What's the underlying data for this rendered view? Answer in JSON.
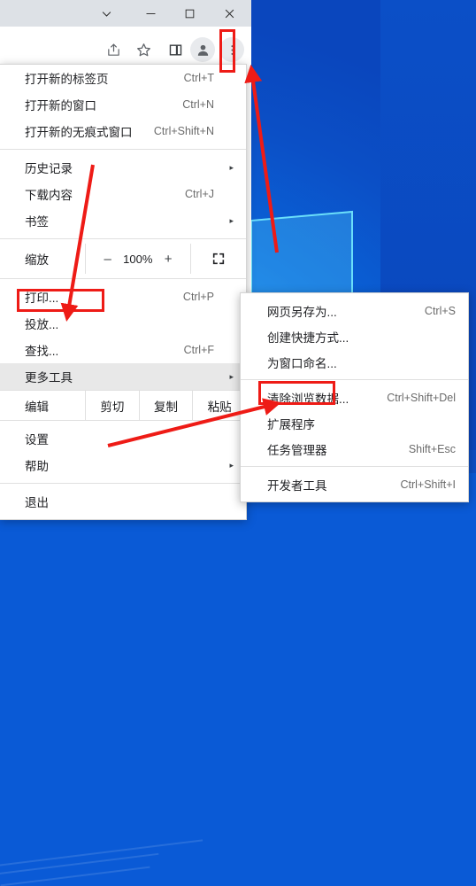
{
  "window": {
    "controls": [
      {
        "name": "chevron-down",
        "glyph": "⌄"
      },
      {
        "name": "minimize",
        "glyph": "—"
      },
      {
        "name": "maximize",
        "glyph": "◻"
      },
      {
        "name": "close",
        "glyph": "✕"
      }
    ]
  },
  "toolbar": {
    "icons": [
      "share-icon",
      "bookmark-star-icon",
      "side-panel-icon",
      "profile-avatar-icon",
      "three-dot-menu-icon"
    ]
  },
  "menu": {
    "group1": [
      {
        "label": "打开新的标签页",
        "accel": "Ctrl+T",
        "arrow": ""
      },
      {
        "label": "打开新的窗口",
        "accel": "Ctrl+N",
        "arrow": ""
      },
      {
        "label": "打开新的无痕式窗口",
        "accel": "Ctrl+Shift+N",
        "arrow": ""
      }
    ],
    "group2": [
      {
        "label": "历史记录",
        "accel": "",
        "arrow": "▸"
      },
      {
        "label": "下载内容",
        "accel": "Ctrl+J",
        "arrow": ""
      },
      {
        "label": "书签",
        "accel": "",
        "arrow": "▸"
      }
    ],
    "zoom": {
      "label": "缩放",
      "minus": "–",
      "value": "100%",
      "plus": "+",
      "fullscreen": "fullscreen-icon"
    },
    "group3": [
      {
        "label": "打印...",
        "accel": "Ctrl+P",
        "arrow": ""
      },
      {
        "label": "投放...",
        "accel": "",
        "arrow": ""
      },
      {
        "label": "查找...",
        "accel": "Ctrl+F",
        "arrow": ""
      },
      {
        "label": "更多工具",
        "accel": "",
        "arrow": "▸",
        "highlighted": true
      }
    ],
    "edit": {
      "label": "编辑",
      "cut": "剪切",
      "copy": "复制",
      "paste": "粘贴"
    },
    "group4": [
      {
        "label": "设置",
        "accel": "",
        "arrow": ""
      },
      {
        "label": "帮助",
        "accel": "",
        "arrow": "▸"
      }
    ],
    "group5": [
      {
        "label": "退出",
        "accel": "",
        "arrow": ""
      }
    ]
  },
  "submenu": {
    "group1": [
      {
        "label": "网页另存为...",
        "accel": "Ctrl+S"
      },
      {
        "label": "创建快捷方式...",
        "accel": ""
      },
      {
        "label": "为窗口命名...",
        "accel": ""
      }
    ],
    "group2": [
      {
        "label": "清除浏览数据...",
        "accel": "Ctrl+Shift+Del"
      },
      {
        "label": "扩展程序",
        "accel": "",
        "highlighted": true
      },
      {
        "label": "任务管理器",
        "accel": "Shift+Esc"
      }
    ],
    "group3": [
      {
        "label": "开发者工具",
        "accel": "Ctrl+Shift+I"
      }
    ]
  },
  "annotations": {
    "accent_color": "#ee1b16",
    "boxes": [
      "three-dot-menu-button",
      "more-tools-menu-item",
      "extensions-menu-item"
    ],
    "arrows": [
      "arrow-to-more-tools",
      "arrow-to-three-dot-menu",
      "arrow-to-extensions"
    ]
  },
  "colors": {
    "desktop_blue": "#0a5ad6",
    "titlebar": "#dde1e6",
    "menu_bg": "#ffffff",
    "highlight": "#e8e8e8",
    "accel_text": "#6b6b6b"
  }
}
